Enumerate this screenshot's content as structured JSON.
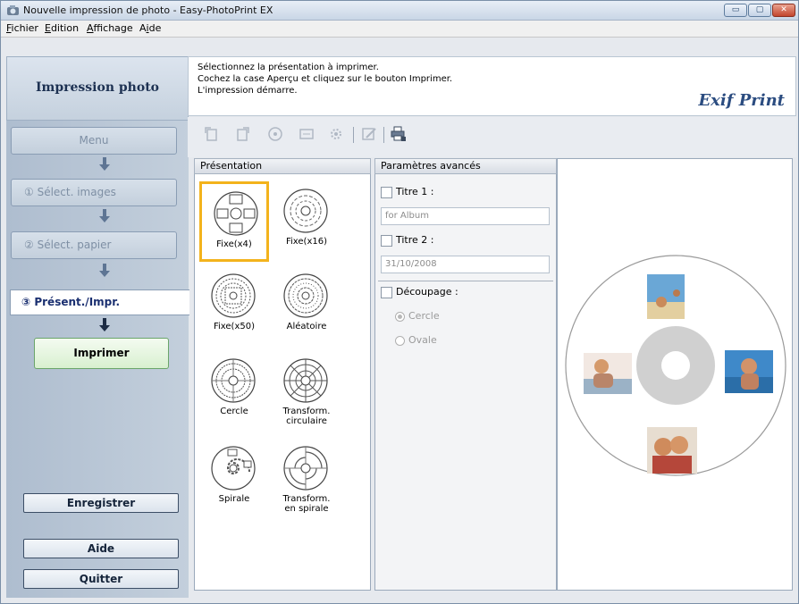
{
  "window": {
    "title": "Nouvelle impression de photo - Easy-PhotoPrint EX",
    "controls": {
      "minimize": "▭",
      "maximize": "▢",
      "close": "✕"
    }
  },
  "menu": [
    {
      "label": "Fichier",
      "key": "F"
    },
    {
      "label": "Edition",
      "key": "E"
    },
    {
      "label": "Affichage",
      "key": "A"
    },
    {
      "label": "Aide",
      "key": "i"
    }
  ],
  "sidebar": {
    "title": "Impression photo",
    "steps": {
      "menu": "Menu",
      "select_images": "① Sélect. images",
      "select_paper": "② Sélect. papier",
      "layout_print": "③  Présent./Impr."
    },
    "print_button": "Imprimer",
    "save_button": "Enregistrer",
    "help_button": "Aide",
    "quit_button": "Quitter"
  },
  "info": {
    "lines": [
      "Sélectionnez la présentation à imprimer.",
      "Cochez la case Aperçu et cliquez sur le bouton Imprimer.",
      "L'impression démarre."
    ],
    "logo": "Exif Print"
  },
  "toolbar": {
    "icons": [
      "rotate-left-icon",
      "rotate-right-icon",
      "disc-icon",
      "frame-icon",
      "settings-icon",
      "edit-icon",
      "print-settings-icon"
    ]
  },
  "layout_panel": {
    "header": "Présentation",
    "items": [
      {
        "label": "Fixe(x4)",
        "selected": true
      },
      {
        "label": "Fixe(x16)",
        "selected": false
      },
      {
        "label": "Fixe(x50)",
        "selected": false
      },
      {
        "label": "Aléatoire",
        "selected": false
      },
      {
        "label": "Cercle",
        "selected": false
      },
      {
        "label": "Transform. circulaire",
        "selected": false
      },
      {
        "label": "Spirale",
        "selected": false
      },
      {
        "label": "Transform. en spirale",
        "selected": false
      }
    ]
  },
  "advanced": {
    "header": "Paramètres avancés",
    "title1_label": "Titre 1 :",
    "title1_value": "for Album",
    "title2_label": "Titre 2 :",
    "title2_value": "31/10/2008",
    "cropping_label": "Découpage :",
    "circle_label": "Cercle",
    "oval_label": "Ovale"
  },
  "colors": {
    "accent_selected": "#f3b31c",
    "print_button": "#d8f0cf",
    "active_step_text": "#1a2f70"
  }
}
